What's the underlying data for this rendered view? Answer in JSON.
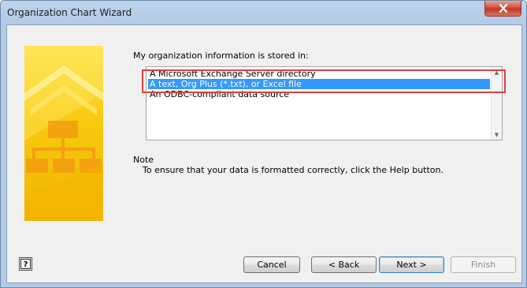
{
  "window": {
    "title": "Organization Chart Wizard",
    "close_icon": "close-icon"
  },
  "main": {
    "prompt": "My organization information is stored in:",
    "options": [
      {
        "label": "A Microsoft Exchange Server directory",
        "selected": false
      },
      {
        "label": "A text, Org Plus (*.txt), or Excel file",
        "selected": true
      },
      {
        "label": "An ODBC-compliant data source",
        "selected": false
      }
    ],
    "note_label": "Note",
    "note_text": "To ensure that your data is formatted correctly, click the Help button."
  },
  "footer": {
    "help_icon": "help-icon",
    "cancel_label": "Cancel",
    "back_label": "< Back",
    "next_label": "Next >",
    "finish_label": "Finish",
    "finish_enabled": false
  },
  "colors": {
    "selection": "#3399ff",
    "highlight_box": "#d9423e",
    "art_yellow": "#f7c90f"
  }
}
